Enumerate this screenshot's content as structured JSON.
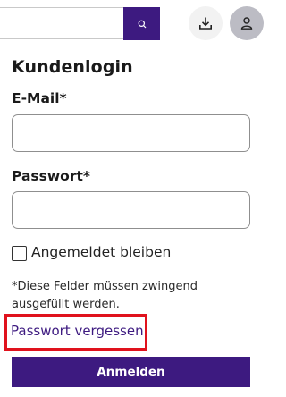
{
  "header": {
    "search": {
      "value": "",
      "placeholder": ""
    },
    "search_button_icon": "search-icon",
    "download_icon": "download-icon",
    "account_icon": "user-icon"
  },
  "login": {
    "title": "Kundenlogin",
    "email_label": "E-Mail*",
    "email_value": "",
    "password_label": "Passwort*",
    "password_value": "",
    "remember_label": "Angemeldet bleiben",
    "remember_checked": false,
    "required_note": "*Diese Felder müssen zwingend ausgefüllt werden.",
    "forgot_link": "Passwort vergessen",
    "submit_label": "Anmelden"
  },
  "colors": {
    "brand": "#3d1a80",
    "highlight": "#e0121d"
  }
}
